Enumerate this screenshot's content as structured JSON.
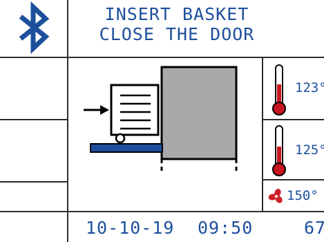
{
  "header": {
    "message_line1": "INSERT BASKET",
    "message_line2": "CLOSE THE DOOR"
  },
  "icons": {
    "bluetooth": "bluetooth-icon",
    "thermometer": "thermometer-icon",
    "fan": "fan-icon"
  },
  "temperatures": {
    "top": "123°",
    "middle": "125°",
    "fan": "150°"
  },
  "footer": {
    "date": "10-10-19",
    "time": "09:50",
    "count": "67"
  },
  "colors": {
    "text_blue": "#1d4f9c",
    "thermometer_red": "#c8141e",
    "fan_red": "#d0202a",
    "chamber_gray": "#a9a9a9",
    "conveyor_blue": "#1f4e9e"
  }
}
